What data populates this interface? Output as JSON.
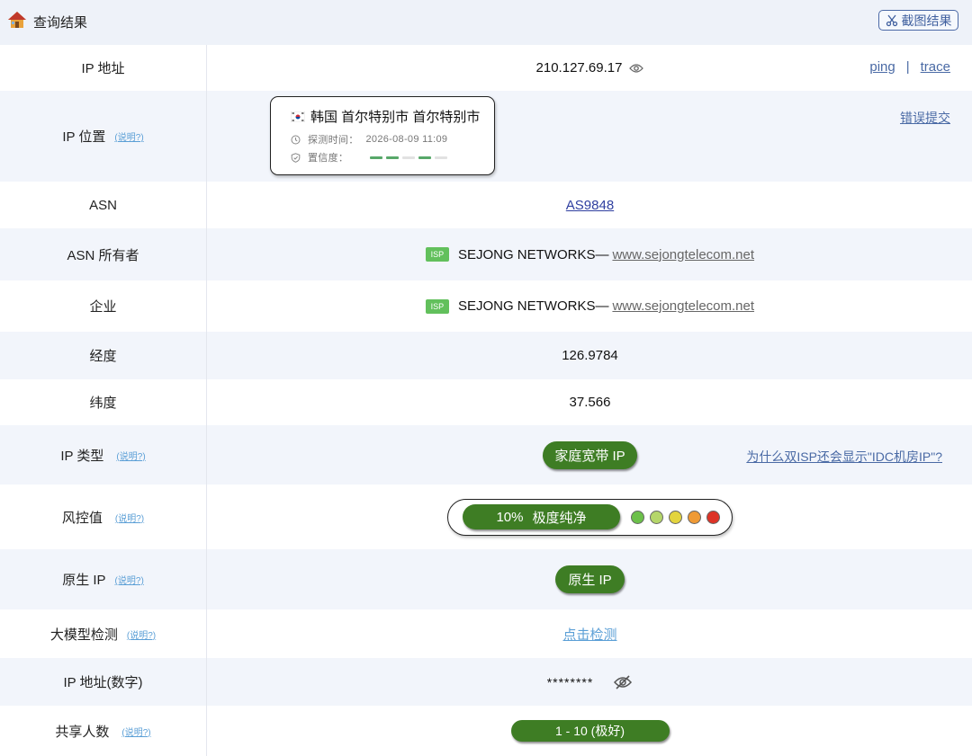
{
  "header": {
    "title": "查询结果",
    "screenshot_label": "截图结果"
  },
  "rows": {
    "ip": {
      "label": "IP 地址",
      "value": "210.127.69.17",
      "ping": "ping",
      "separator": "|",
      "trace": "trace"
    },
    "location": {
      "label": "IP 位置",
      "note": "(说明?)",
      "place": "韩国 首尔特别市 首尔特别市",
      "time_label": "探测时间：",
      "time_value": "2026-08-09 11:09",
      "confidence_label": "置信度：",
      "confidence_segments": [
        1,
        1,
        0,
        1,
        0
      ],
      "report": "错误提交"
    },
    "asn": {
      "label": "ASN",
      "value": "AS9848"
    },
    "asn_owner": {
      "label": "ASN 所有者",
      "badge": "ISP",
      "name": "SEJONG NETWORKS—",
      "site": "www.sejongtelecom.net"
    },
    "company": {
      "label": "企业",
      "badge": "ISP",
      "name": "SEJONG NETWORKS—",
      "site": "www.sejongtelecom.net"
    },
    "longitude": {
      "label": "经度",
      "value": "126.9784"
    },
    "latitude": {
      "label": "纬度",
      "value": "37.566"
    },
    "ip_type": {
      "label": "IP 类型",
      "note": "(说明?)",
      "value": "家庭宽带 IP",
      "question": "为什么双ISP还会显示\"IDC机房IP\"?"
    },
    "risk": {
      "label": "风控值",
      "note": "(说明?)",
      "percent": "10%",
      "level": "极度纯净",
      "dot_colors": [
        "#6cc04a",
        "#b5d66a",
        "#e3d43e",
        "#ef9a35",
        "#dd3327"
      ]
    },
    "native": {
      "label": "原生 IP",
      "note": "(说明?)",
      "value": "原生 IP"
    },
    "llm": {
      "label": "大模型检测",
      "note": "(说明?)",
      "value": "点击检测"
    },
    "ip_numeric": {
      "label": "IP 地址(数字)",
      "value": "********"
    },
    "shared": {
      "label": "共享人数",
      "note": "(说明?)",
      "value": "1 - 10 (极好)"
    }
  },
  "colors": {
    "accent": "#3e7d24",
    "link": "#4a6aa5",
    "note": "#5b9fd6",
    "header_bg": "#eef2f9",
    "alt_row_bg": "#f2f5fb"
  }
}
